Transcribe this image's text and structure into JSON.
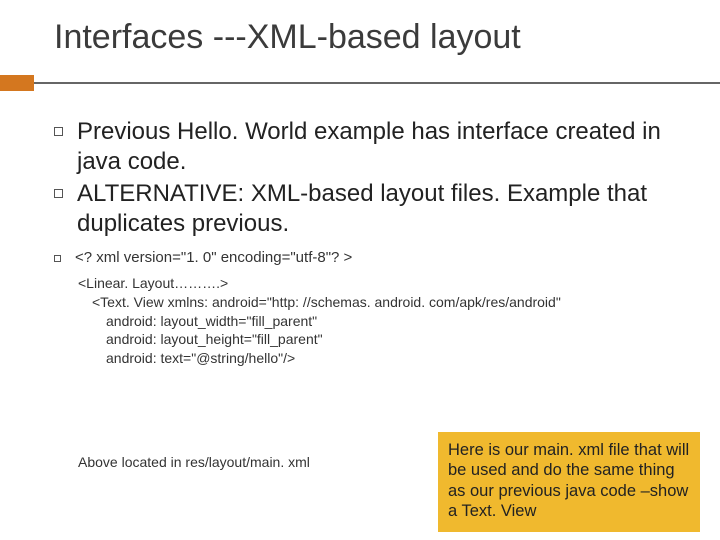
{
  "title": "Interfaces ---XML-based layout",
  "bullets": {
    "b1": "Previous Hello. World example has interface created in java code.",
    "b2": "ALTERNATIVE:  XML-based layout files. Example that duplicates previous.",
    "b3": "<? xml version=\"1. 0\" encoding=\"utf-8\"? >"
  },
  "code": {
    "l1": "<Linear. Layout……….>",
    "l2": "<Text. View xmlns: android=\"http: //schemas. android. com/apk/res/android\"",
    "l3": "android: layout_width=\"fill_parent\"",
    "l4": "android: layout_height=\"fill_parent\"",
    "l5": "android: text=\"@string/hello\"/>"
  },
  "footer": "Above located in res/layout/main. xml",
  "callout": "Here is our main. xml file that will be used and do the same thing as our previous java code –show a Text. View"
}
